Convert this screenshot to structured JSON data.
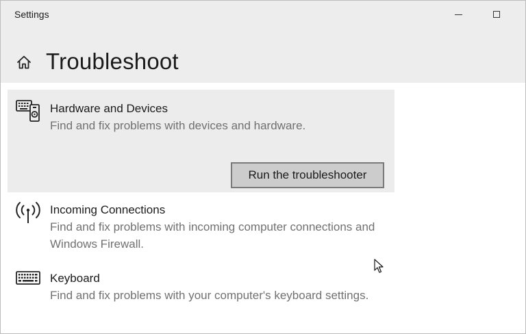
{
  "window": {
    "app_title": "Settings"
  },
  "header": {
    "title": "Troubleshoot"
  },
  "items": [
    {
      "title": "Hardware and Devices",
      "description": "Find and fix problems with devices and hardware.",
      "icon": "hardware-devices-icon",
      "selected": true,
      "button_label": "Run the troubleshooter"
    },
    {
      "title": "Incoming Connections",
      "description": "Find and fix problems with incoming computer connections and Windows Firewall.",
      "icon": "antenna-signal-icon"
    },
    {
      "title": "Keyboard",
      "description": "Find and fix problems with your computer's keyboard settings.",
      "icon": "keyboard-icon"
    }
  ],
  "colors": {
    "header_bg": "#ededed",
    "selected_item_bg": "#ececec",
    "button_bg": "#cccccc",
    "button_border": "#7a7a7a",
    "description_text": "#707070"
  }
}
